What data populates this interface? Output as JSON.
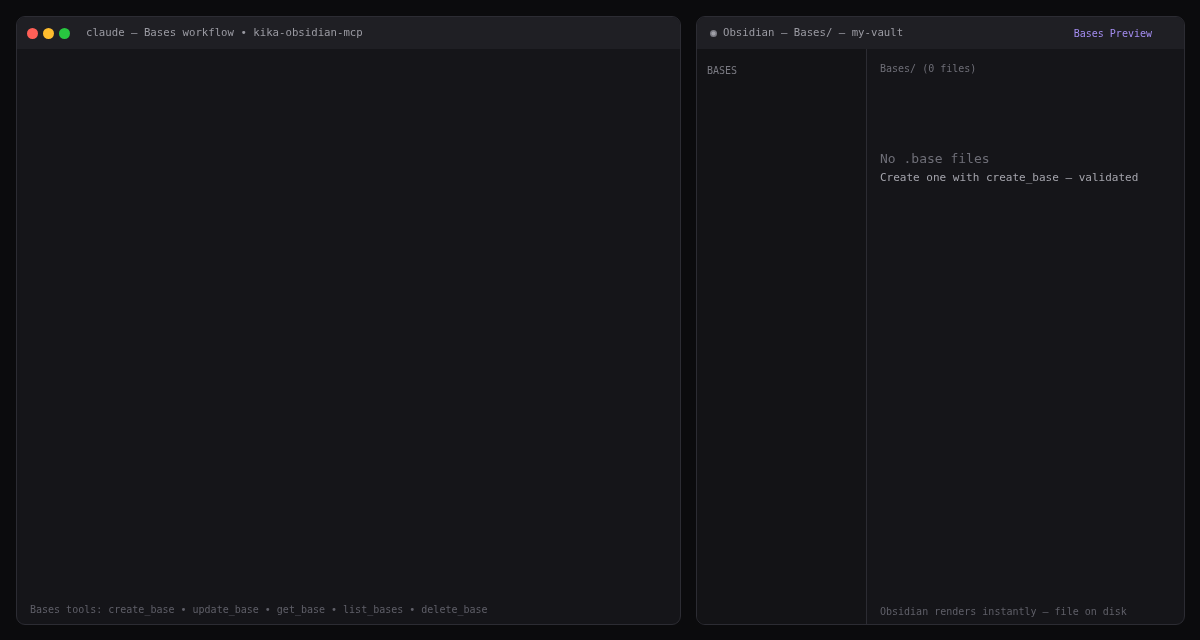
{
  "terminal": {
    "title": "claude — Bases workflow • kika-obsidian-mcp",
    "footer": "Bases tools: create_base • update_base • get_base • list_bases • delete_base"
  },
  "obsidian": {
    "title": "Obsidian — Bases/ — my-vault",
    "badge": "Bases Preview",
    "sidebar": {
      "heading": "BASES"
    },
    "main": {
      "path": "Bases/ (0 files)",
      "empty_title": "No .base files",
      "empty_hint": "Create one with create_base — validated",
      "footer": "Obsidian renders instantly — file on disk"
    }
  }
}
